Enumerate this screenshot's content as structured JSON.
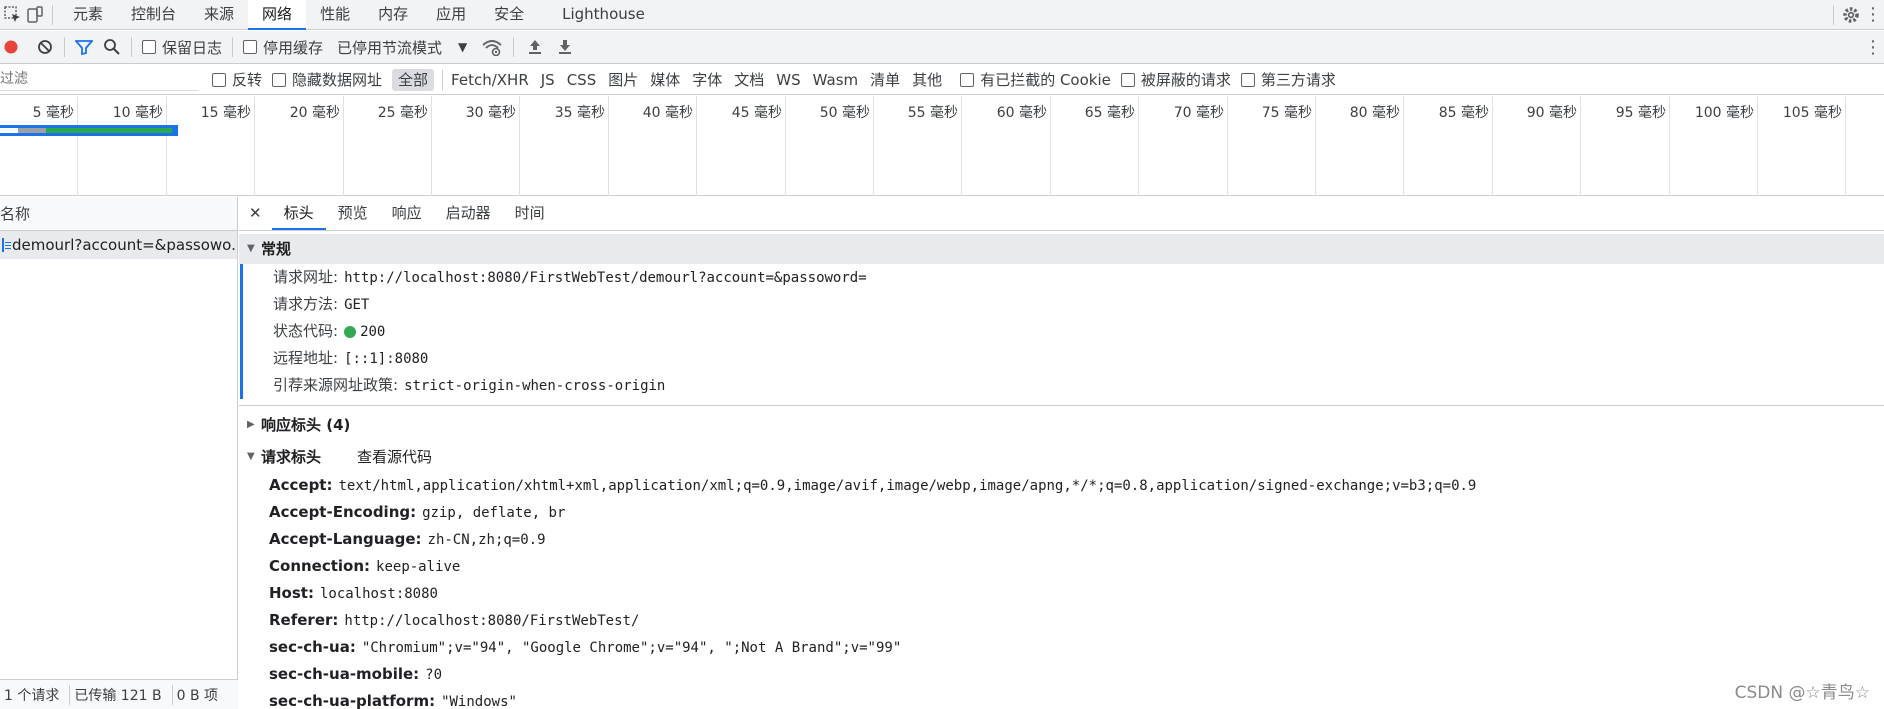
{
  "tabbar": {
    "tabs": [
      "元素",
      "控制台",
      "来源",
      "网络",
      "性能",
      "内存",
      "应用",
      "安全",
      "Lighthouse"
    ],
    "active_index": 3
  },
  "toolbar": {
    "preserve_log": "保留日志",
    "disable_cache": "停用缓存",
    "throttle": "已停用节流模式"
  },
  "filterbar": {
    "placeholder": "过滤",
    "invert": "反转",
    "hide_data_urls": "隐藏数据网址",
    "types": [
      "全部",
      "Fetch/XHR",
      "JS",
      "CSS",
      "图片",
      "媒体",
      "字体",
      "文档",
      "WS",
      "Wasm",
      "清单",
      "其他"
    ],
    "selected_type": "全部",
    "blocked_cookies": "有已拦截的 Cookie",
    "blocked_requests": "被屏蔽的请求",
    "third_party": "第三方请求"
  },
  "overview": {
    "ticks": [
      "5 毫秒",
      "10 毫秒",
      "15 毫秒",
      "20 毫秒",
      "25 毫秒",
      "30 毫秒",
      "35 毫秒",
      "40 毫秒",
      "45 毫秒",
      "50 毫秒",
      "55 毫秒",
      "60 毫秒",
      "65 毫秒",
      "70 毫秒",
      "75 毫秒",
      "80 毫秒",
      "85 毫秒",
      "90 毫秒",
      "95 毫秒",
      "100 毫秒",
      "105 毫秒"
    ]
  },
  "request_list": {
    "column_name": "名称",
    "requests": [
      {
        "name": "demourl?account=&passowo..."
      }
    ],
    "status": {
      "requests": "1 个请求",
      "transferred": "已传输 121 B",
      "resources": "0 B 项"
    }
  },
  "detail": {
    "tabs": [
      "标头",
      "预览",
      "响应",
      "启动器",
      "时间"
    ],
    "active_index": 0,
    "general": {
      "title": "常规",
      "rows": [
        {
          "key": "请求网址:",
          "value": "http://localhost:8080/FirstWebTest/demourl?account=&passoword="
        },
        {
          "key": "请求方法:",
          "value": "GET"
        },
        {
          "key": "状态代码:",
          "value": "200"
        },
        {
          "key": "远程地址:",
          "value": "[::1]:8080"
        },
        {
          "key": "引荐来源网址政策:",
          "value": "strict-origin-when-cross-origin"
        }
      ]
    },
    "response_headers": {
      "title": "响应标头 (4)"
    },
    "request_headers": {
      "title": "请求标头",
      "view_source": "查看源代码",
      "rows": [
        {
          "key": "Accept:",
          "value": "text/html,application/xhtml+xml,application/xml;q=0.9,image/avif,image/webp,image/apng,*/*;q=0.8,application/signed-exchange;v=b3;q=0.9"
        },
        {
          "key": "Accept-Encoding:",
          "value": "gzip, deflate, br"
        },
        {
          "key": "Accept-Language:",
          "value": "zh-CN,zh;q=0.9"
        },
        {
          "key": "Connection:",
          "value": "keep-alive"
        },
        {
          "key": "Host:",
          "value": "localhost:8080"
        },
        {
          "key": "Referer:",
          "value": "http://localhost:8080/FirstWebTest/"
        },
        {
          "key": "sec-ch-ua:",
          "value": "\"Chromium\";v=\"94\", \"Google Chrome\";v=\"94\", \";Not A Brand\";v=\"99\""
        },
        {
          "key": "sec-ch-ua-mobile:",
          "value": "?0"
        },
        {
          "key": "sec-ch-ua-platform:",
          "value": "\"Windows\""
        }
      ]
    }
  },
  "watermark": "CSDN @☆青鸟☆",
  "colors": {
    "accent": "#1a73e8",
    "record": "#e8453c",
    "status_ok": "#34a853"
  }
}
